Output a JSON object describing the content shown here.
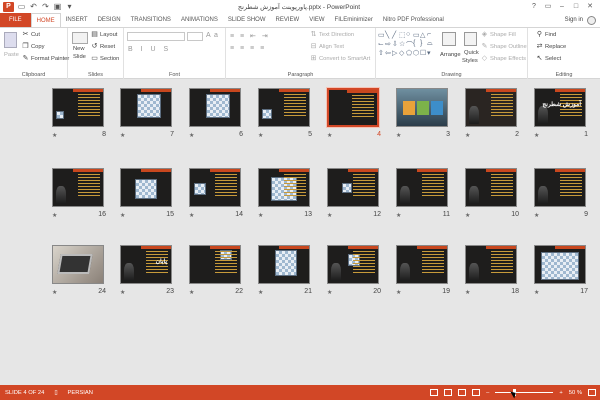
{
  "window": {
    "title": "پاورپوینت آموزش شطرنج.pptx - PowerPoint",
    "app_icon": "P",
    "sign_in": "Sign in"
  },
  "quick_access": [
    "save-icon",
    "undo-icon",
    "redo-icon",
    "present-icon",
    "customize-icon"
  ],
  "tabs": [
    "FILE",
    "HOME",
    "INSERT",
    "DESIGN",
    "TRANSITIONS",
    "ANIMATIONS",
    "SLIDE SHOW",
    "REVIEW",
    "VIEW",
    "FILEminimizer",
    "Nitro PDF Professional"
  ],
  "active_tab": "HOME",
  "ribbon": {
    "clipboard": {
      "label": "Clipboard",
      "paste": "Paste",
      "cut": "Cut",
      "copy": "Copy",
      "format_painter": "Format Painter"
    },
    "slides": {
      "label": "Slides",
      "new_slide": "New",
      "new_slide2": "Slide",
      "layout": "Layout",
      "reset": "Reset",
      "section": "Section"
    },
    "font": {
      "label": "Font"
    },
    "paragraph": {
      "label": "Paragraph",
      "text_direction": "Text Direction",
      "align_text": "Align Text",
      "convert_smartart": "Convert to SmartArt"
    },
    "drawing": {
      "label": "Drawing",
      "arrange": "Arrange",
      "quick_styles": "Quick",
      "quick_styles2": "Styles",
      "shape_fill": "Shape Fill",
      "shape_outline": "Shape Outline",
      "shape_effects": "Shape Effects"
    },
    "editing": {
      "label": "Editing",
      "find": "Find",
      "replace": "Replace",
      "select": "Select"
    }
  },
  "slides": [
    {
      "num": "8"
    },
    {
      "num": "7"
    },
    {
      "num": "6"
    },
    {
      "num": "5"
    },
    {
      "num": "4"
    },
    {
      "num": "3"
    },
    {
      "num": "2"
    },
    {
      "num": "1",
      "title": "آموزش شطرنج"
    },
    {
      "num": "16"
    },
    {
      "num": "15"
    },
    {
      "num": "14"
    },
    {
      "num": "13"
    },
    {
      "num": "12"
    },
    {
      "num": "11"
    },
    {
      "num": "10"
    },
    {
      "num": "9"
    },
    {
      "num": "24"
    },
    {
      "num": "23",
      "title": "پایان"
    },
    {
      "num": "22"
    },
    {
      "num": "21"
    },
    {
      "num": "20"
    },
    {
      "num": "19"
    },
    {
      "num": "18"
    },
    {
      "num": "17"
    }
  ],
  "selected_slide": "4",
  "status": {
    "slide_indicator": "SLIDE 4 OF 24",
    "language": "PERSIAN",
    "zoom": "50 %"
  },
  "colors": {
    "accent": "#d24726"
  }
}
